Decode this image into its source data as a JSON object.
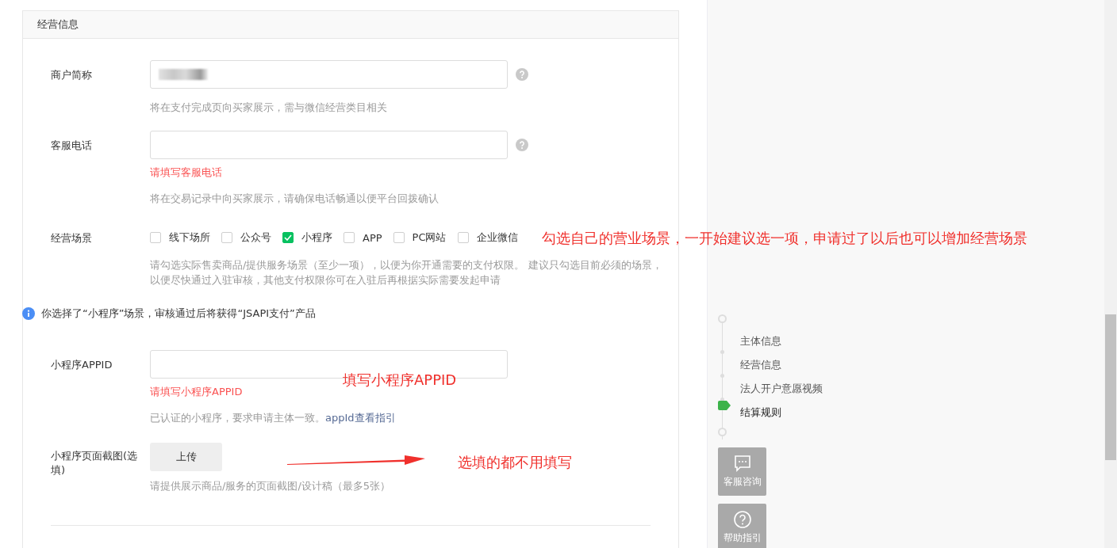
{
  "section": {
    "title": "经营信息"
  },
  "fields": [
    {
      "kind": "help-input",
      "label": "商户简称",
      "redacted": true,
      "hint": "将在支付完成页向买家展示，需与微信经营类目相关"
    },
    {
      "kind": "help-input",
      "label": "客服电话",
      "redacted": false,
      "error": "请填写客服电话",
      "hint": "将在交易记录中向买家展示，请确保电话畅通以便平台回拨确认"
    },
    {
      "kind": "scenes",
      "label": "经营场景",
      "options": [
        {
          "label": "线下场所",
          "checked": false
        },
        {
          "label": "公众号",
          "checked": false
        },
        {
          "label": "小程序",
          "checked": true
        },
        {
          "label": "APP",
          "checked": false
        },
        {
          "label": "PC网站",
          "checked": false
        },
        {
          "label": "企业微信",
          "checked": false
        }
      ],
      "hint_lines": [
        "请勾选实际售卖商品/提供服务场景（至少一项），以便为你开通需要的支付权限。 建议只勾选目前必须的场景，",
        "以便尽快通过入驻审核，其他支付权限你可在入驻后再根据实际需要发起申请"
      ]
    },
    {
      "kind": "info",
      "text": "你选择了“小程序”场景，审核通过后将获得“JSAPI支付”产品"
    },
    {
      "kind": "input",
      "label": "小程序APPID",
      "redacted": false,
      "error": "请填写小程序APPID",
      "hint": "已认证的小程序，要求申请主体一致。",
      "hint_link": "appId查看指引"
    },
    {
      "kind": "upload",
      "label": "小程序页面截图(选填)",
      "button": "上传",
      "hint": "请提供展示商品/服务的页面截图/设计稿（最多5张）"
    }
  ],
  "steps": [
    {
      "label": "主体信息",
      "selected": false
    },
    {
      "label": "经营信息",
      "selected": false
    },
    {
      "label": "法人开户意愿视频",
      "selected": false
    },
    {
      "label": "结算规则",
      "selected": true
    }
  ],
  "side_buttons": [
    {
      "kind": "chat",
      "label": "客服咨询"
    },
    {
      "kind": "help",
      "label": "帮助指引"
    }
  ],
  "annotations": [
    {
      "text": "勾选自己的营业场景，一开始建议选一项，申请过了以后也可以增加经营场景"
    },
    {
      "text": "填写小程序APPID"
    },
    {
      "text": "选填的都不用填写"
    }
  ]
}
